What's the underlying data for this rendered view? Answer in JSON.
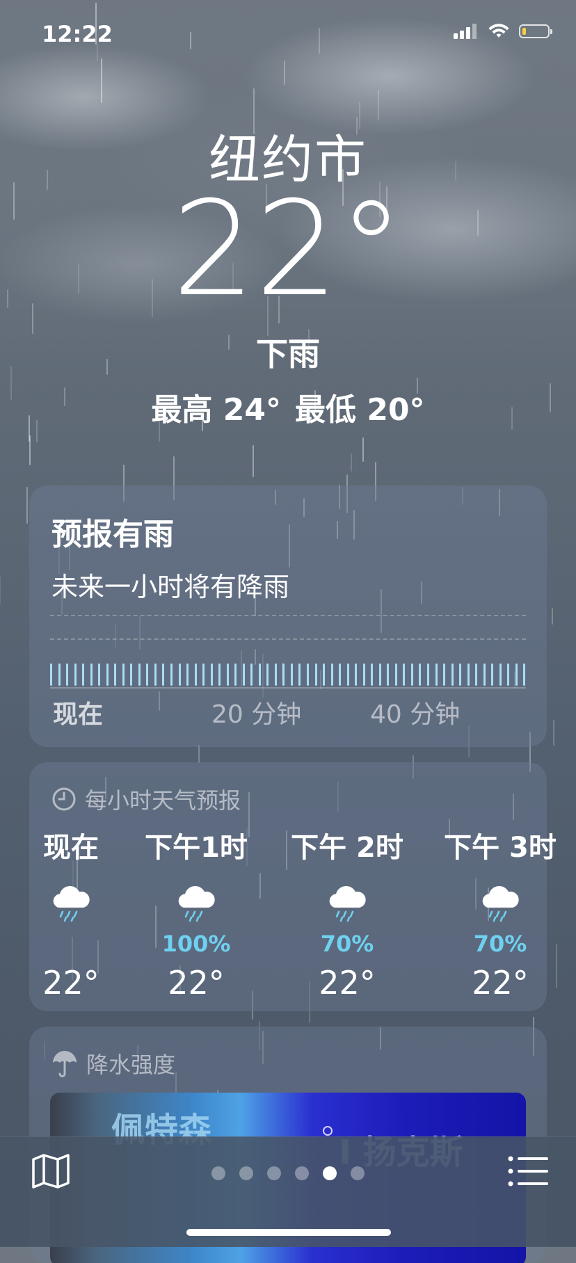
{
  "status_bar": {
    "time": "12:22"
  },
  "location": {
    "city": "纽约市",
    "temperature": "22",
    "degree": "°",
    "condition": "下雨",
    "high": "最高 24°",
    "low": "最低 20°"
  },
  "rain_forecast": {
    "title": "预报有雨",
    "subtitle": "未来一小时将有降雨",
    "axis_labels": [
      "现在",
      "20 分钟",
      "40 分钟"
    ],
    "bar_count": 60
  },
  "hourly": {
    "header": "每小时天气预报",
    "items": [
      {
        "time": "现在",
        "icon": "rain-cloud-icon",
        "chance": "",
        "temp": "22°"
      },
      {
        "time": "下午1时",
        "icon": "rain-cloud-icon",
        "chance": "100%",
        "temp": "22°"
      },
      {
        "time": "下午 2时",
        "icon": "rain-cloud-icon",
        "chance": "70%",
        "temp": "22°"
      },
      {
        "time": "下午 3时",
        "icon": "rain-cloud-icon",
        "chance": "70%",
        "temp": "22°"
      }
    ]
  },
  "precipitation": {
    "header": "降水强度",
    "map_labels": [
      "佩特森",
      "Ⅰ 扬克斯"
    ]
  },
  "bottom_bar": {
    "page_count": 6,
    "active_page": 5
  },
  "colors": {
    "accent_percent": "#6fd0ef",
    "rain_bar": "#a9dcf7"
  }
}
